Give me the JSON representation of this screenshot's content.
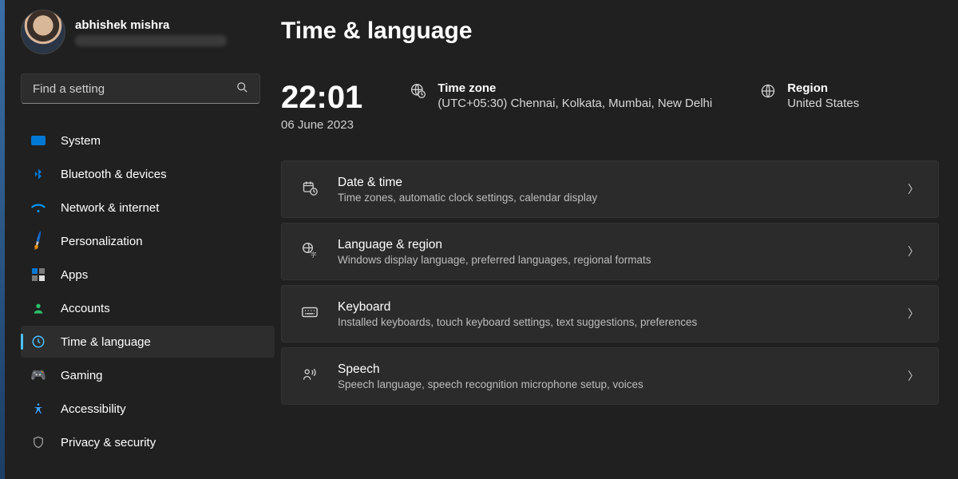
{
  "user": {
    "name": "abhishek mishra"
  },
  "search": {
    "placeholder": "Find a setting"
  },
  "nav": {
    "items": [
      {
        "label": "System"
      },
      {
        "label": "Bluetooth & devices"
      },
      {
        "label": "Network & internet"
      },
      {
        "label": "Personalization"
      },
      {
        "label": "Apps"
      },
      {
        "label": "Accounts"
      },
      {
        "label": "Time & language"
      },
      {
        "label": "Gaming"
      },
      {
        "label": "Accessibility"
      },
      {
        "label": "Privacy & security"
      }
    ]
  },
  "page": {
    "title": "Time & language",
    "clock": {
      "time": "22:01",
      "date": "06 June 2023"
    },
    "timezone": {
      "label": "Time zone",
      "value": "(UTC+05:30) Chennai, Kolkata, Mumbai, New Delhi"
    },
    "region": {
      "label": "Region",
      "value": "United States"
    },
    "cards": [
      {
        "title": "Date & time",
        "sub": "Time zones, automatic clock settings, calendar display"
      },
      {
        "title": "Language & region",
        "sub": "Windows display language, preferred languages, regional formats"
      },
      {
        "title": "Keyboard",
        "sub": "Installed keyboards, touch keyboard settings, text suggestions, preferences"
      },
      {
        "title": "Speech",
        "sub": "Speech language, speech recognition microphone setup, voices"
      }
    ]
  }
}
